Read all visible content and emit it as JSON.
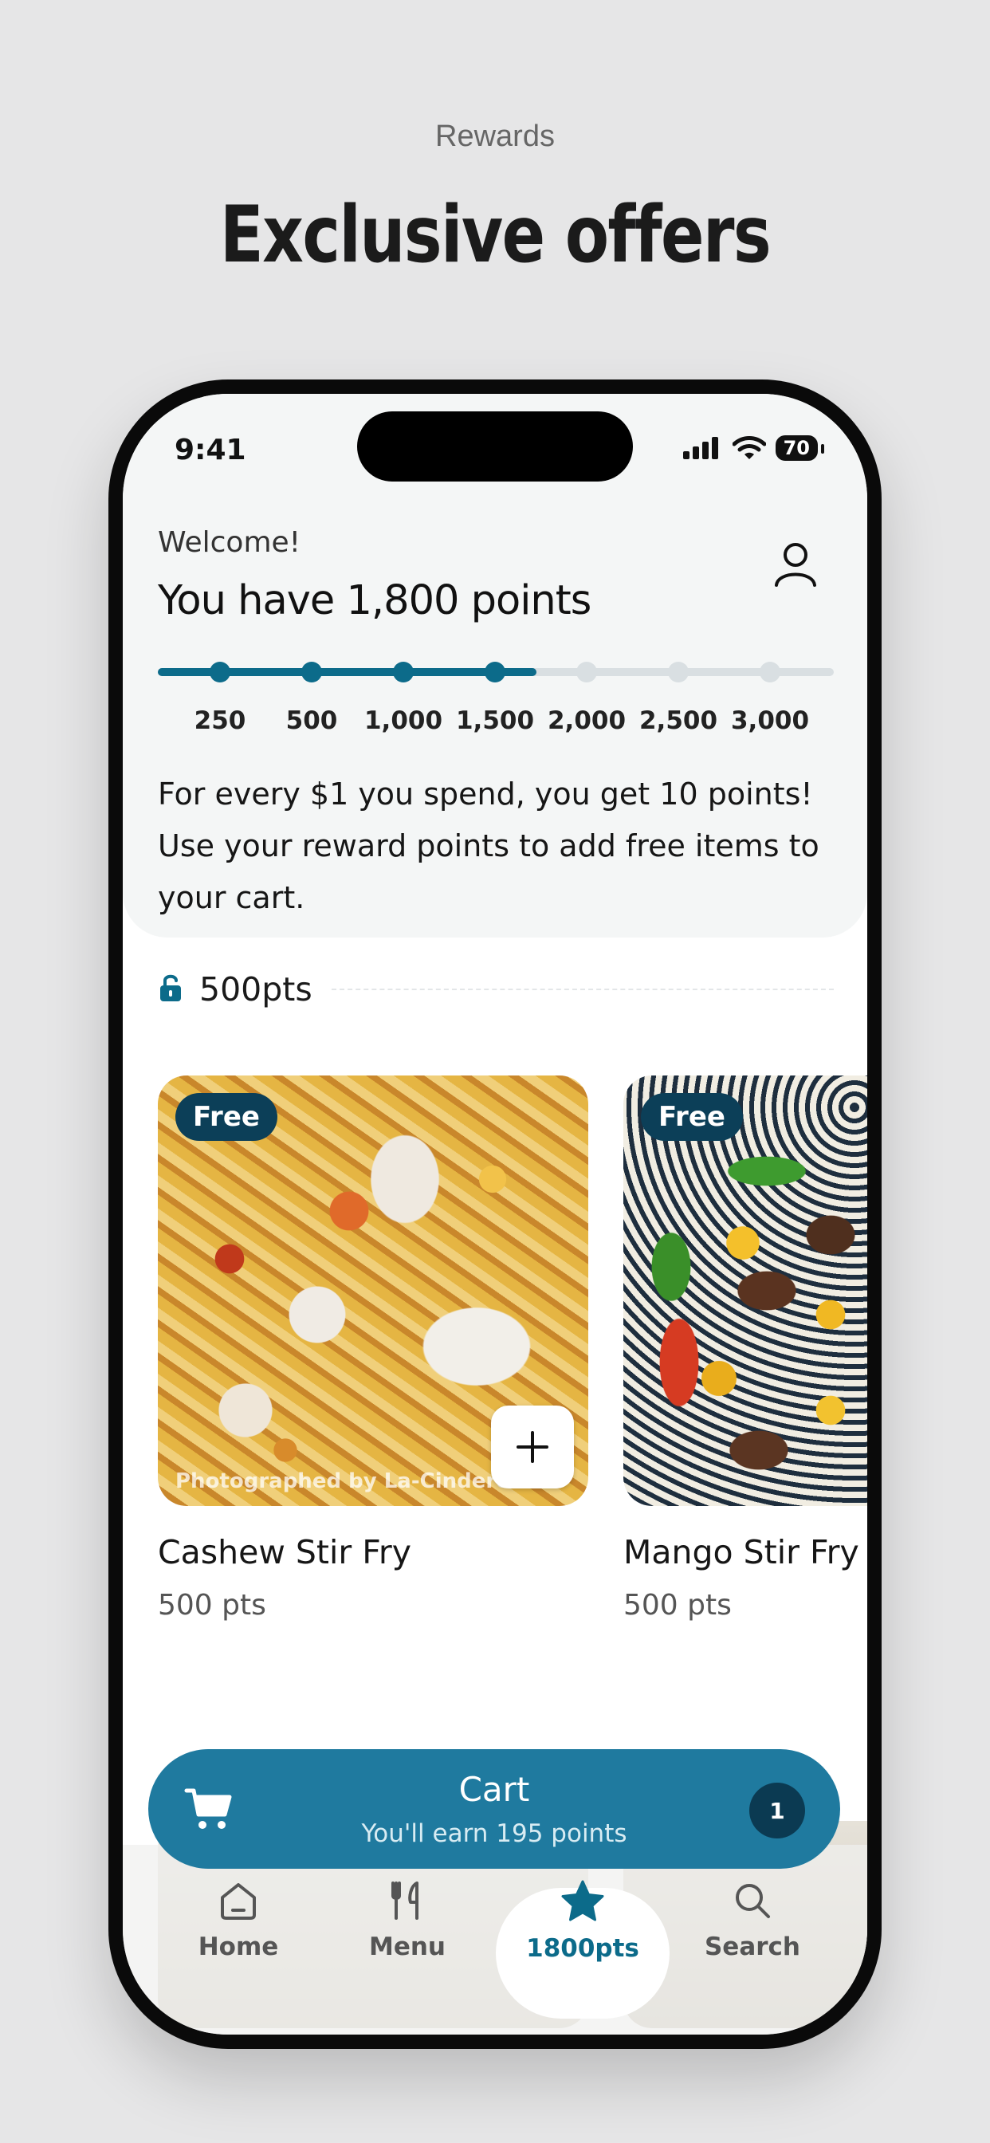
{
  "page": {
    "eyebrow": "Rewards",
    "headline": "Exclusive offers"
  },
  "status_bar": {
    "time": "9:41",
    "battery": "70"
  },
  "header": {
    "welcome": "Welcome!",
    "points_title": "You have 1,800 points",
    "current_points": 1800,
    "milestones": [
      "250",
      "500",
      "1,000",
      "1,500",
      "2,000",
      "2,500",
      "3,000"
    ],
    "milestones_reached": 4,
    "progress_fraction": 0.56,
    "info_text": "For every $1 you spend, you get 10 points! Use your reward points to add free items to your cart."
  },
  "tier": {
    "label": "500pts",
    "icon": "unlock-icon"
  },
  "items": [
    {
      "badge": "Free",
      "name": "Cashew Stir Fry",
      "points": "500 pts",
      "watermark": "Photographed by La-Cinderell",
      "add_label": "+"
    },
    {
      "badge": "Free",
      "name": "Mango Stir Fry",
      "points": "500 pts"
    }
  ],
  "cart": {
    "title": "Cart",
    "subtitle": "You'll earn 195 points",
    "count": "1"
  },
  "nav": {
    "items": [
      {
        "label": "Home",
        "icon": "home-icon"
      },
      {
        "label": "Menu",
        "icon": "utensils-icon"
      },
      {
        "label": "1800pts",
        "icon": "star-icon",
        "active": true
      },
      {
        "label": "Search",
        "icon": "search-icon"
      }
    ]
  },
  "colors": {
    "accent": "#0c6b8a",
    "cart": "#1f7a9f",
    "badge": "#0c3f58",
    "track": "#d9dfe2"
  }
}
